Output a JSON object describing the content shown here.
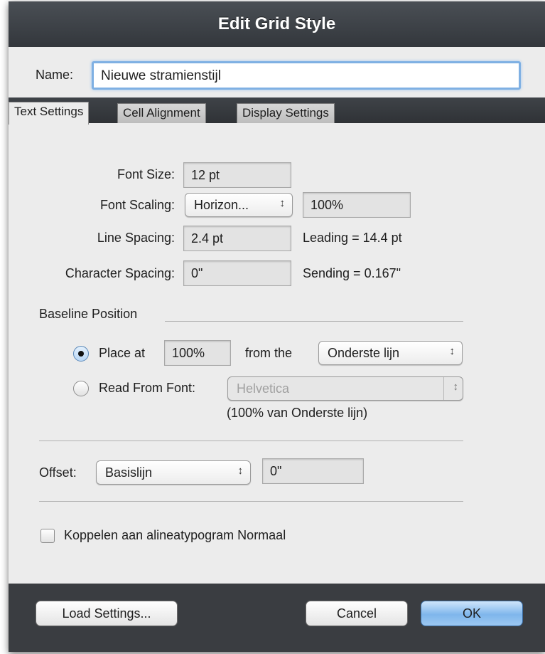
{
  "window": {
    "title": "Edit Grid Style"
  },
  "name": {
    "label": "Name:",
    "value": "Nieuwe stramienstijl"
  },
  "tabs": [
    {
      "label": "Text Settings",
      "active": true
    },
    {
      "label": "Cell Alignment",
      "active": false
    },
    {
      "label": "Display Settings",
      "active": false
    }
  ],
  "text_settings": {
    "font_size": {
      "label": "Font Size:",
      "value": "12 pt"
    },
    "font_scaling": {
      "label": "Font Scaling:",
      "mode": "Horizon...",
      "value": "100%"
    },
    "line_spacing": {
      "label": "Line Spacing:",
      "value": "2.4 pt",
      "info": "Leading = 14.4 pt"
    },
    "character_spacing": {
      "label": "Character Spacing:",
      "value": "0\"",
      "info": "Sending = 0.167\""
    }
  },
  "baseline": {
    "heading": "Baseline Position",
    "place_at": {
      "label": "Place at",
      "value": "100%",
      "from_label": "from the",
      "reference": "Onderste lijn",
      "selected": true
    },
    "read_from_font": {
      "label": "Read From Font:",
      "font": "Helvetica",
      "note": "(100% van Onderste lijn)",
      "selected": false
    }
  },
  "offset": {
    "label": "Offset:",
    "mode": "Basislijn",
    "value": "0\""
  },
  "link": {
    "label": "Koppelen aan alineatypogram Normaal",
    "checked": false
  },
  "buttons": {
    "load_settings": "Load Settings...",
    "cancel": "Cancel",
    "ok": "OK"
  },
  "icons": {
    "popup_arrows": "updown-arrows-icon"
  },
  "colors": {
    "titlebar": "#3a3e43",
    "focus_ring": "#7fb0e3",
    "default_button": "#7fb6ec",
    "background": "#ececec"
  }
}
